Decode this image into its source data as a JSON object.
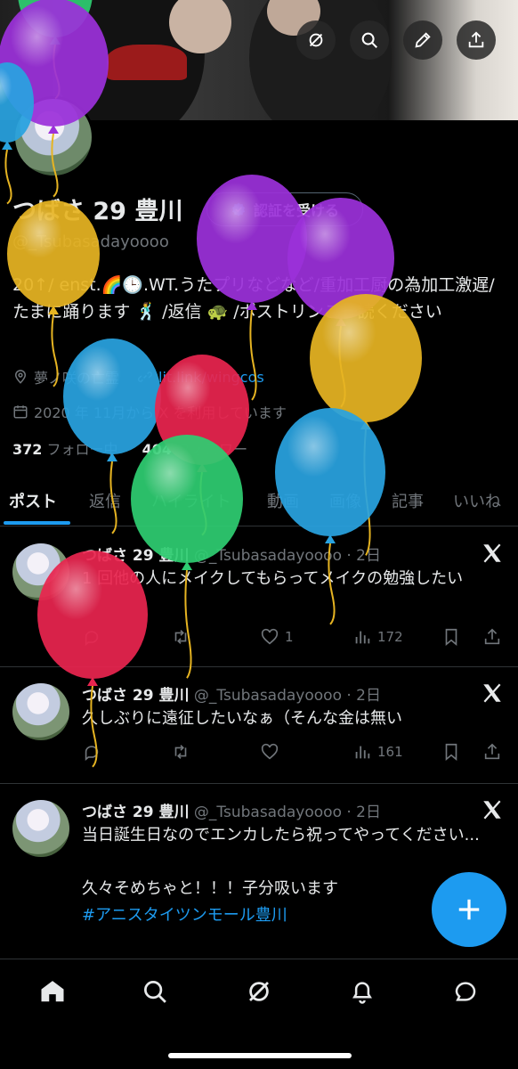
{
  "profile": {
    "display_name": "つばさ 29 豊川",
    "handle": "@_Tsubasadayoooo",
    "verify_button": "認証を受ける",
    "bio": "20↑/ enst.🌈🕒.WT.うたプリなどなど/重加工厨の為加工激遅/たまに踊ります 🕺 /返信 🐢 /ポストリンご一読ください",
    "location": "夢ノ咲の亡霊",
    "link": "lit.link/wingcos",
    "joined": "2020 年 11月から X を利用しています",
    "following_count": "372",
    "following_label": "フォロー中",
    "followers_count": "404",
    "followers_label": "フォロワー"
  },
  "header_buttons": [
    "grok-icon",
    "search-icon",
    "edit-icon",
    "share-icon"
  ],
  "tabs": [
    "ポスト",
    "返信",
    "ハイライト",
    "動画",
    "画像",
    "記事",
    "いいね"
  ],
  "posts": [
    {
      "name": "つばさ 29 豊川",
      "handle": "@_Tsubasadayoooo · 2日",
      "text": "1 回他の人にメイクしてもらってメイクの勉強したい",
      "replies": "",
      "reposts": "",
      "likes": "1",
      "views": "172"
    },
    {
      "name": "つばさ 29 豊川",
      "handle": "@_Tsubasadayoooo · 2日",
      "text": "久しぶりに遠征したいなぁ（そんな金は無い",
      "replies": "",
      "reposts": "",
      "likes": "",
      "views": "161"
    },
    {
      "name": "つばさ 29 豊川",
      "handle": "@_Tsubasadayoooo · 2日",
      "text": "当日誕生日なのでエンカしたら祝ってやってください...\n\n久々そめちゃと！！！子分吸います",
      "hashtag": "#アニスタイツンモール豊川"
    }
  ],
  "bottom_nav": [
    "home-icon",
    "search-icon",
    "grok-icon",
    "notifications-icon",
    "messages-icon"
  ],
  "colors": {
    "accent": "#1d9bf0",
    "background": "#000000",
    "muted": "#71767b",
    "text": "#e7e9ea"
  },
  "balloon_colors": [
    "#2ecc71",
    "#9b30d9",
    "#29a3e0",
    "#e6b422",
    "#e8254f"
  ]
}
